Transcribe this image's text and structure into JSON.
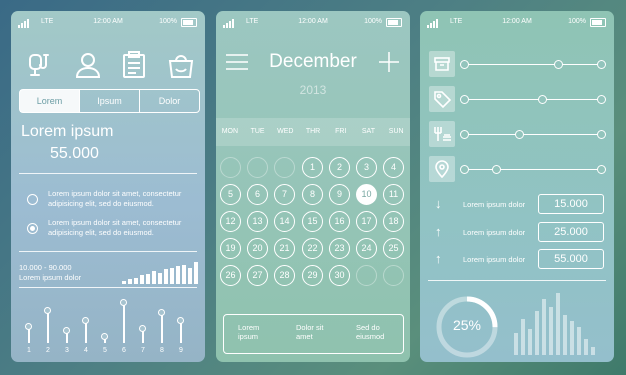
{
  "status": {
    "network": "LTE",
    "time": "12:00 AM",
    "battery": "100%"
  },
  "screen1": {
    "icons": [
      "stethoscope-icon",
      "person-icon",
      "clipboard-icon",
      "shopping-bag-icon"
    ],
    "tabs": [
      "Lorem",
      "Ipsum",
      "Dolor"
    ],
    "heading": "Lorem ipsum",
    "amount": "55.000",
    "options": [
      {
        "text": "Lorem ipsum dolor sit amet, consectetur adipisicing elit, sed do eiusmod.",
        "checked": false
      },
      {
        "text": "Lorem ipsum dolor sit amet, consectetur adipisicing elit, sed do eiusmod.",
        "checked": true
      }
    ],
    "range": "10.000 - 90.000",
    "range_label": "Lorem ipsum dolor",
    "slider_numbers": [
      "1",
      "2",
      "3",
      "4",
      "5",
      "6",
      "7",
      "8",
      "9"
    ]
  },
  "screen2": {
    "month": "December",
    "year": "2013",
    "weekdays": [
      "MON",
      "TUE",
      "WED",
      "THR",
      "FRI",
      "SAT",
      "SUN"
    ],
    "days": [
      "1",
      "2",
      "3",
      "4",
      "5",
      "6",
      "7",
      "8",
      "9",
      "10",
      "11",
      "12",
      "13",
      "14",
      "15",
      "16",
      "17",
      "18",
      "19",
      "20",
      "21",
      "22",
      "23",
      "24",
      "25",
      "26",
      "27",
      "28",
      "29",
      "30"
    ],
    "today": "10",
    "legend": [
      "Lorem ipsum",
      "Dolor sit amet",
      "Sed do eiusmod"
    ]
  },
  "screen3": {
    "slider_icons": [
      "archive-icon",
      "tag-icon",
      "food-icon",
      "location-pin-icon"
    ],
    "rows": [
      {
        "arrow": "↓",
        "label": "Lorem ipsum dolor",
        "value": "15.000"
      },
      {
        "arrow": "↑",
        "label": "Lorem ipsum dolor",
        "value": "25.000"
      },
      {
        "arrow": "↑",
        "label": "Lorem ipsum dolor",
        "value": "55.000"
      }
    ],
    "donut_label": "25%",
    "donut_fraction": 0.25
  }
}
